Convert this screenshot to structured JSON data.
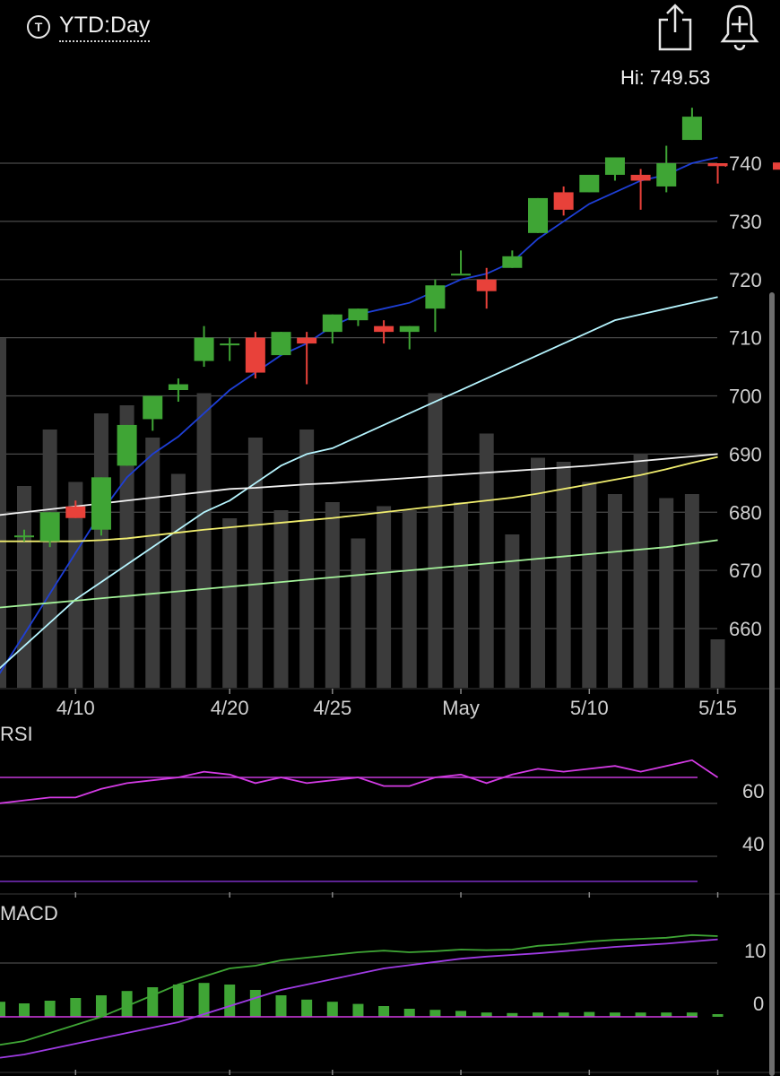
{
  "header": {
    "ticker_icon": "T",
    "range_label": "YTD:Day",
    "share_icon": "share-icon",
    "alert_icon": "add-alert-bell-icon"
  },
  "hi_label": "Hi: 749.53",
  "chart_data": [
    {
      "type": "candlestick",
      "price_axis": {
        "ticks": [
          740,
          730,
          720,
          710,
          700,
          690,
          680,
          670,
          660
        ],
        "range": [
          655,
          768
        ]
      },
      "x_tick_labels": [
        "4/10",
        "4/20",
        "4/25",
        "May",
        "5/10",
        "5/15"
      ],
      "x_tick_slots": [
        2,
        8,
        12,
        17,
        22,
        27
      ],
      "colors": {
        "up": "#3fa535",
        "down": "#e8413a",
        "ma_blue": "#1e3fd6",
        "ma_cyan": "#b6f5ff",
        "ma_white": "#f2f2f2",
        "ma_yellow": "#f1ee6f",
        "ma_green": "#a4f29a",
        "volume": "#3b3b3b"
      },
      "candles": [
        {
          "o": 676,
          "h": 677,
          "l": 675,
          "c": 676
        },
        {
          "o": 675,
          "h": 680,
          "l": 674,
          "c": 680
        },
        {
          "o": 681,
          "h": 682,
          "l": 679,
          "c": 679
        },
        {
          "o": 677,
          "h": 686,
          "l": 676,
          "c": 686
        },
        {
          "o": 688,
          "h": 695,
          "l": 688,
          "c": 695
        },
        {
          "o": 696,
          "h": 700,
          "l": 694,
          "c": 700
        },
        {
          "o": 701,
          "h": 703,
          "l": 699,
          "c": 702
        },
        {
          "o": 706,
          "h": 712,
          "l": 705,
          "c": 710
        },
        {
          "o": 709,
          "h": 710,
          "l": 706,
          "c": 709
        },
        {
          "o": 710,
          "h": 711,
          "l": 703,
          "c": 704
        },
        {
          "o": 707,
          "h": 711,
          "l": 707,
          "c": 711
        },
        {
          "o": 710,
          "h": 711,
          "l": 702,
          "c": 709
        },
        {
          "o": 711,
          "h": 714,
          "l": 709,
          "c": 714
        },
        {
          "o": 713,
          "h": 715,
          "l": 712,
          "c": 715
        },
        {
          "o": 712,
          "h": 713,
          "l": 709,
          "c": 711
        },
        {
          "o": 711,
          "h": 712,
          "l": 708,
          "c": 712
        },
        {
          "o": 715,
          "h": 720,
          "l": 711,
          "c": 719
        },
        {
          "o": 721,
          "h": 725,
          "l": 721,
          "c": 721
        },
        {
          "o": 720,
          "h": 722,
          "l": 715,
          "c": 718
        },
        {
          "o": 722,
          "h": 725,
          "l": 722,
          "c": 724
        },
        {
          "o": 728,
          "h": 734,
          "l": 728,
          "c": 734
        },
        {
          "o": 735,
          "h": 736,
          "l": 731,
          "c": 732
        },
        {
          "o": 735,
          "h": 738,
          "l": 735,
          "c": 738
        },
        {
          "o": 738,
          "h": 741,
          "l": 737,
          "c": 741
        },
        {
          "o": 738,
          "h": 739,
          "l": 732,
          "c": 737
        },
        {
          "o": 736,
          "h": 743,
          "l": 735,
          "c": 740
        },
        {
          "o": 744,
          "h": 749.53,
          "l": 744,
          "c": 748
        },
        {
          "o": 740,
          "h": 740,
          "l": 736.5,
          "c": 739.5
        }
      ],
      "current_price": 739.5,
      "moving_averages": [
        {
          "color_key": "ma_blue",
          "values": [
            659,
            666,
            673,
            680,
            686,
            690,
            693,
            697,
            701,
            704,
            707,
            709,
            712,
            714,
            715,
            716,
            718,
            720,
            721,
            723,
            727,
            730,
            733,
            735,
            737,
            738,
            740,
            741
          ]
        },
        {
          "color_key": "ma_cyan",
          "values": [
            657,
            661,
            665,
            668,
            671,
            674,
            677,
            680,
            682,
            685,
            688,
            690,
            691,
            693,
            695,
            697,
            699,
            701,
            703,
            705,
            707,
            709,
            711,
            713,
            714,
            715,
            716,
            717
          ]
        },
        {
          "color_key": "ma_white",
          "values": [
            680,
            680.5,
            681,
            681.5,
            682,
            682.5,
            683,
            683.5,
            684,
            684.2,
            684.5,
            684.8,
            685,
            685.3,
            685.6,
            685.9,
            686.2,
            686.5,
            686.8,
            687.1,
            687.4,
            687.7,
            688,
            688.4,
            688.8,
            689.2,
            689.6,
            690
          ]
        },
        {
          "color_key": "ma_yellow",
          "values": [
            675,
            675,
            675,
            675.2,
            675.5,
            676,
            676.5,
            677,
            677.4,
            677.8,
            678.2,
            678.6,
            679,
            679.5,
            680,
            680.5,
            681,
            681.5,
            682,
            682.5,
            683.2,
            684,
            684.8,
            685.6,
            686.4,
            687.4,
            688.5,
            689.5
          ]
        },
        {
          "color_key": "ma_green",
          "values": [
            664,
            664.4,
            664.8,
            665.2,
            665.6,
            666,
            666.4,
            666.8,
            667.2,
            667.6,
            668,
            668.4,
            668.8,
            669.2,
            669.6,
            670,
            670.4,
            670.8,
            671.2,
            671.6,
            672,
            672.4,
            672.8,
            673.2,
            673.6,
            674,
            674.6,
            675.2
          ]
        }
      ],
      "volume": [
        50,
        64,
        51,
        68,
        70,
        62,
        53,
        73,
        42,
        62,
        44,
        64,
        46,
        37,
        45,
        44,
        73,
        46,
        63,
        38,
        57,
        56,
        51,
        48,
        58,
        47,
        48,
        12
      ]
    },
    {
      "type": "line",
      "title": "RSI",
      "y_ticks": [
        60,
        40
      ],
      "y_range": [
        30,
        80
      ],
      "reference_lines": [
        70,
        34
      ],
      "series": [
        {
          "color": "#d33be4",
          "values": [
            62,
            63,
            63,
            66,
            68,
            69,
            70,
            72,
            71,
            68,
            70,
            68,
            69,
            70,
            67,
            67,
            70,
            71,
            68,
            71,
            73,
            72,
            73,
            74,
            72,
            74,
            76,
            70
          ]
        }
      ]
    },
    {
      "type": "bar",
      "title": "MACD",
      "y_ticks": [
        10,
        0
      ],
      "y_range": [
        -10,
        18
      ],
      "histogram": [
        2.5,
        3,
        3.5,
        4,
        4.8,
        5.5,
        6,
        6.3,
        6,
        5,
        4,
        3.2,
        2.8,
        2.4,
        2,
        1.5,
        1.3,
        1.1,
        0.8,
        0.7,
        0.8,
        0.8,
        0.9,
        0.8,
        0.8,
        0.8,
        0.8,
        0.5
      ],
      "series": [
        {
          "color": "#3fa535",
          "values": [
            -4.5,
            -3,
            -1.5,
            0,
            2,
            4,
            6,
            7.5,
            9,
            9.5,
            10.5,
            11,
            11.5,
            12,
            12.3,
            12,
            12.2,
            12.5,
            12.4,
            12.5,
            13.2,
            13.5,
            14,
            14.3,
            14.5,
            14.7,
            15.2,
            15
          ]
        },
        {
          "color": "#9f3be4",
          "values": [
            -7,
            -6,
            -5,
            -4,
            -3,
            -2,
            -1,
            0.5,
            2,
            3.5,
            5,
            6,
            7,
            8,
            9,
            9.6,
            10.2,
            10.8,
            11.2,
            11.5,
            11.8,
            12.2,
            12.6,
            13,
            13.3,
            13.6,
            14,
            14.4
          ]
        }
      ]
    }
  ]
}
